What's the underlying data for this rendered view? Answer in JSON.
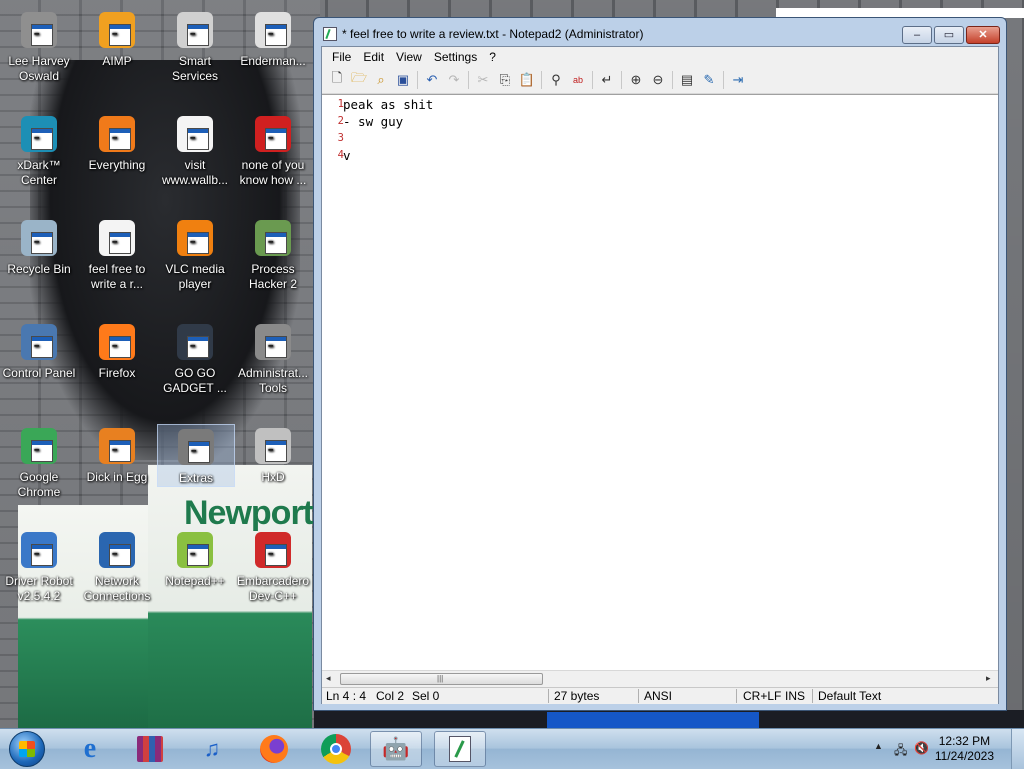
{
  "desktop": {
    "icons": [
      {
        "label": "Lee Harvey Oswald",
        "icon": "portrait-icon",
        "color": "#8f8f8f"
      },
      {
        "label": "AIMP",
        "icon": "aimp-icon",
        "color": "#f0a020"
      },
      {
        "label": "Smart Services",
        "icon": "gear-services-icon",
        "color": "#d0d0d0"
      },
      {
        "label": "Enderman...",
        "icon": "folder-shortcut-icon",
        "color": "#e0e0e0"
      },
      {
        "label": "xDark™ Center",
        "icon": "xdark-orb-icon",
        "color": "#1d8fb5"
      },
      {
        "label": "Everything",
        "icon": "everything-search-icon",
        "color": "#f07a1a"
      },
      {
        "label": "visit www.wallb...",
        "icon": "text-document-icon",
        "color": "#f4f4f4"
      },
      {
        "label": "none of you know how ...",
        "icon": "bomb-icon",
        "color": "#d02020"
      },
      {
        "label": "Recycle Bin",
        "icon": "recycle-bin-icon",
        "color": "#9ab4c8"
      },
      {
        "label": "feel free to write a r...",
        "icon": "text-document-icon",
        "color": "#f4f4f4"
      },
      {
        "label": "VLC media player",
        "icon": "vlc-cone-icon",
        "color": "#f08010"
      },
      {
        "label": "Process Hacker 2",
        "icon": "process-hacker-icon",
        "color": "#6a9a50"
      },
      {
        "label": "Control Panel",
        "icon": "control-panel-icon",
        "color": "#4a78b0"
      },
      {
        "label": "Firefox",
        "icon": "firefox-icon",
        "color": "#ff7a1a"
      },
      {
        "label": "GO GO GADGET ...",
        "icon": "gadget-icon",
        "color": "#303a48"
      },
      {
        "label": "Administrat... Tools",
        "icon": "admin-tools-icon",
        "color": "#8a8a8a"
      },
      {
        "label": "Google Chrome",
        "icon": "chrome-icon",
        "color": "#3aa757"
      },
      {
        "label": "Dick in Egg",
        "icon": "egg-icon",
        "color": "#e88020"
      },
      {
        "label": "Extras",
        "icon": "extras-folder-icon",
        "color": "#7a7a7a"
      },
      {
        "label": "HxD",
        "icon": "hxd-icon",
        "color": "#c0c0c0"
      },
      {
        "label": "Driver Robot v2.5.4.2",
        "icon": "driver-robot-icon",
        "color": "#3a78c8"
      },
      {
        "label": "Network Connections",
        "icon": "network-icon",
        "color": "#2a66b0"
      },
      {
        "label": "Notepad++",
        "icon": "notepadpp-icon",
        "color": "#8ac040"
      },
      {
        "label": "Embarcadero Dev-C++",
        "icon": "devcpp-icon",
        "color": "#d02a2a"
      }
    ]
  },
  "window": {
    "title": "* feel free to write a review.txt - Notepad2 (Administrator)",
    "controls": {
      "minimize": "‒",
      "maximize": "▭",
      "close": "✕"
    }
  },
  "menu": [
    "File",
    "Edit",
    "View",
    "Settings",
    "?"
  ],
  "editor": {
    "lines": [
      {
        "num": "1",
        "text": "peak as shit"
      },
      {
        "num": "2",
        "text": "- sw guy"
      },
      {
        "num": "3",
        "text": ""
      },
      {
        "num": "4",
        "text": "v"
      }
    ]
  },
  "hscroll": {
    "left": "◂",
    "right": "▸",
    "grip": "|||"
  },
  "status": {
    "position": "Ln 4 : 4",
    "col": "Col 2",
    "sel": "Sel 0",
    "size": "27 bytes",
    "encoding": "ANSI",
    "eol": "CR+LF",
    "ins": "INS",
    "scheme": "Default Text"
  },
  "taskbar": {
    "clock_time": "12:32 PM",
    "clock_date": "11/24/2023",
    "tray_up": "▲"
  }
}
